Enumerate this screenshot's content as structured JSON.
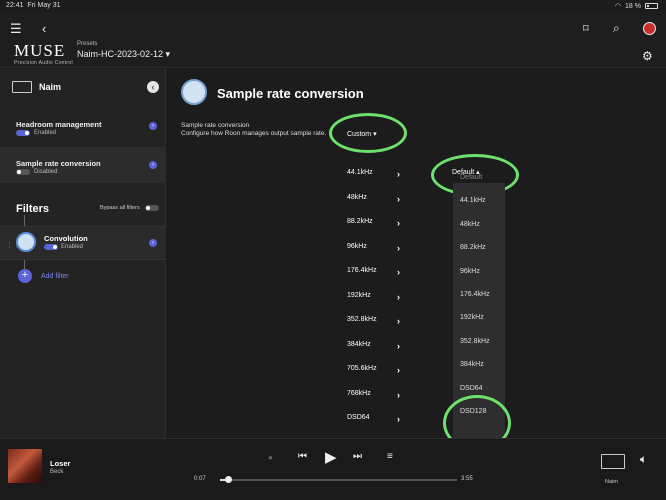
{
  "status": {
    "time": "22:41",
    "date": "Fri May 31",
    "battery": "18 %"
  },
  "header": {
    "brand": "MUSE",
    "brand_sub": "Precision Audio Control",
    "presets_label": "Presets",
    "preset_value": "Naim-HC-2023-02-12",
    "menu_icon": "hamburger-icon",
    "back_icon": "back-arrow-icon",
    "right_icons": [
      "bookmark-icon",
      "search-icon",
      "profile-avatar-icon",
      "gear-icon"
    ]
  },
  "sidebar": {
    "device": "Naim",
    "headroom": {
      "title": "Headroom management",
      "state": "Enabled"
    },
    "src": {
      "title": "Sample rate conversion",
      "state": "Disabled"
    },
    "filters_title": "Filters",
    "bypass_label": "Bypass all filters",
    "convolution": {
      "title": "Convolution",
      "state": "Enabled"
    },
    "add_filter": "Add filter"
  },
  "main": {
    "title": "Sample rate conversion",
    "desc_title": "Sample rate conversion",
    "desc_body": "Configure how Roon manages output sample rate.",
    "mode_value": "Custom",
    "default_label": "Default",
    "rates": [
      "44.1kHz",
      "48kHz",
      "88.2kHz",
      "96kHz",
      "176.4kHz",
      "192kHz",
      "352.8kHz",
      "384kHz",
      "705.6kHz",
      "768kHz",
      "DSD64"
    ],
    "dropdown_options": [
      "Default",
      "44.1kHz",
      "48kHz",
      "88.2kHz",
      "96kHz",
      "176.4kHz",
      "192kHz",
      "352.8kHz",
      "384kHz",
      "DSD64",
      "DSD128"
    ]
  },
  "player": {
    "song": "Loser",
    "artist": "Beck",
    "elapsed": "0:07",
    "duration": "3:55",
    "zone": "Naim",
    "progress_fraction": 0.03
  }
}
